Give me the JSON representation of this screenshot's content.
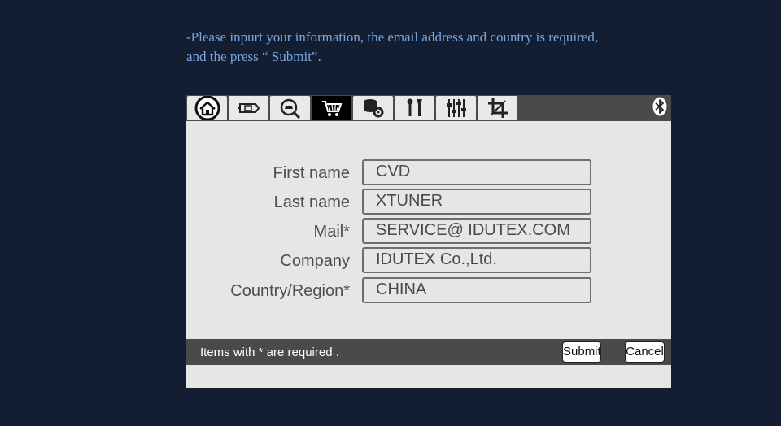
{
  "instructions": {
    "line1": "-Please inpurt your information, the email address and country is required,",
    "line2": "and the press “ Submit”."
  },
  "toolbar": {
    "items": [
      {
        "icon": "home-icon"
      },
      {
        "icon": "obd-connector-icon"
      },
      {
        "icon": "car-diagnose-icon"
      },
      {
        "icon": "cart-icon",
        "active": true
      },
      {
        "icon": "database-settings-icon"
      },
      {
        "icon": "tools-icon"
      },
      {
        "icon": "sliders-icon"
      },
      {
        "icon": "crop-icon"
      }
    ],
    "bluetooth_icon": "bluetooth-icon"
  },
  "form": {
    "fields": [
      {
        "label": "First name",
        "value": "CVD"
      },
      {
        "label": "Last name",
        "value": "XTUNER"
      },
      {
        "label": "Mail*",
        "value": "SERVICE@ IDUTEX.COM"
      },
      {
        "label": "Company",
        "value": "IDUTEX Co.,Ltd."
      },
      {
        "label": "Country/Region*",
        "value": "CHINA"
      }
    ]
  },
  "footer": {
    "status": "Items with * are required .",
    "submit_label": "Submit",
    "cancel_label": "Cancel"
  },
  "colors": {
    "page_background": "#141e33",
    "instruction_text": "#7aa6dd",
    "device_background": "#e6e6e4",
    "bar_background": "#4a4a4a",
    "active_tab": "#000000"
  }
}
